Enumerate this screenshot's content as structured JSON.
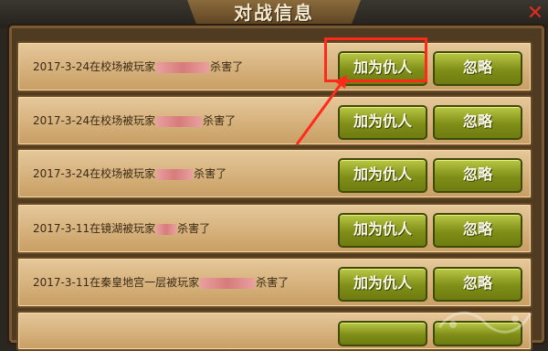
{
  "window": {
    "title": "对战信息"
  },
  "rows": [
    {
      "date": "2017-3-24",
      "prefix": "在校场被玩家",
      "suffix": "杀害了",
      "enemy_btn": "加为仇人",
      "ignore_btn": "忽略"
    },
    {
      "date": "2017-3-24",
      "prefix": "在校场被玩家",
      "suffix": "杀害了",
      "enemy_btn": "加为仇人",
      "ignore_btn": "忽略"
    },
    {
      "date": "2017-3-24",
      "prefix": "在校场被玩家",
      "suffix": "杀害了",
      "enemy_btn": "加为仇人",
      "ignore_btn": "忽略"
    },
    {
      "date": "2017-3-11",
      "prefix": "在镜湖被玩家",
      "suffix": "杀害了",
      "enemy_btn": "加为仇人",
      "ignore_btn": "忽略"
    },
    {
      "date": "2017-3-11",
      "prefix": "在秦皇地宫一层被玩家",
      "suffix": "杀害了",
      "enemy_btn": "加为仇人",
      "ignore_btn": "忽略"
    }
  ],
  "colors": {
    "highlight": "#ff2a1a",
    "button": "#8a9a1c",
    "row": "#d9b27a"
  }
}
